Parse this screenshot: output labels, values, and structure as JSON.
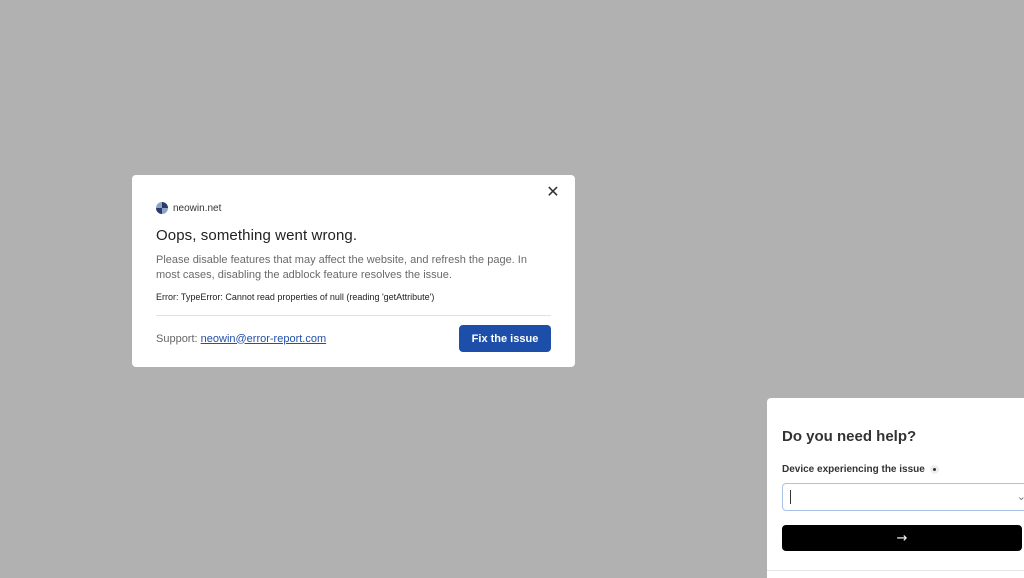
{
  "modal": {
    "close_icon": "close-icon",
    "close_glyph": "✕",
    "site_logo_icon": "neowin-logo-icon",
    "site_name": "neowin.net",
    "title": "Oops, something went wrong.",
    "description": "Please disable features that may affect the website, and refresh the page. In most cases, disabling the adblock feature resolves the issue.",
    "error": "Error: TypeError: Cannot read properties of null (reading 'getAttribute')",
    "support_label": "Support: ",
    "support_email": "neowin@error-report.com",
    "fix_button": "Fix the issue",
    "fix_button_color": "#1d4faa"
  },
  "help_panel": {
    "title": "Do you need help?",
    "device_label": "Device experiencing the issue",
    "device_value": "",
    "chevron_icon": "chevron-down-icon",
    "chevron_glyph": "⌄",
    "submit_icon": "arrow-right-icon",
    "submit_glyph": "→"
  },
  "colors": {
    "backdrop": "#b1b1b1",
    "link": "#2350a8"
  }
}
